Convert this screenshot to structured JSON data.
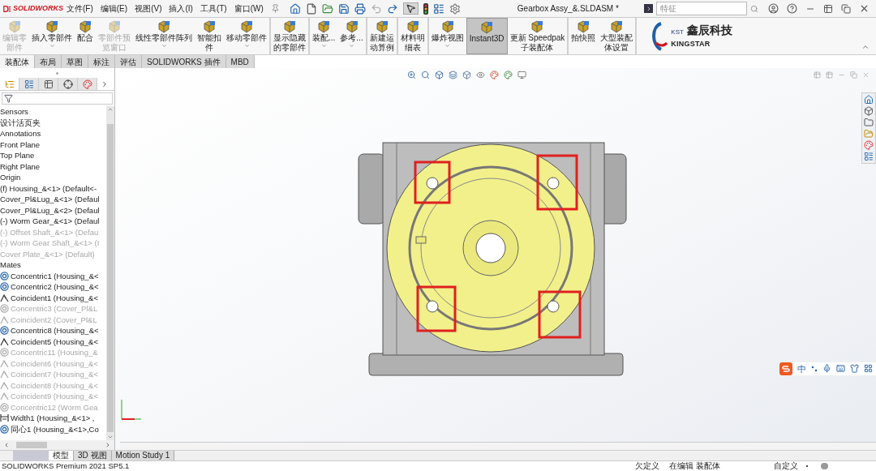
{
  "app": {
    "logo": "SOLIDWORKS",
    "menus": [
      "文件(F)",
      "编辑(E)",
      "视图(V)",
      "插入(I)",
      "工具(T)",
      "窗口(W)"
    ],
    "title": "Gearbox Assy_&.SLDASM *",
    "search": {
      "placeholder": "特征"
    }
  },
  "ribbon": {
    "buttons": [
      {
        "lines": [
          "编辑零",
          "部件"
        ],
        "disabled": true,
        "dropdown": false,
        "selected": false,
        "divider_after": false
      },
      {
        "lines": [
          "插入零部件"
        ],
        "disabled": false,
        "dropdown": true,
        "selected": false,
        "divider_after": false
      },
      {
        "lines": [
          "配合"
        ],
        "disabled": false,
        "dropdown": false,
        "selected": false,
        "divider_after": false
      },
      {
        "lines": [
          "零部件预",
          "览窗口"
        ],
        "disabled": true,
        "dropdown": false,
        "selected": false,
        "divider_after": false
      },
      {
        "lines": [
          "线性零部件阵列"
        ],
        "disabled": false,
        "dropdown": true,
        "selected": false,
        "divider_after": false
      },
      {
        "lines": [
          "智能扣",
          "件"
        ],
        "disabled": false,
        "dropdown": false,
        "selected": false,
        "divider_after": false
      },
      {
        "lines": [
          "移动零部件"
        ],
        "disabled": false,
        "dropdown": true,
        "selected": false,
        "divider_after": true
      },
      {
        "lines": [
          "显示隐藏",
          "的零部件"
        ],
        "disabled": false,
        "dropdown": false,
        "selected": false,
        "divider_after": true
      },
      {
        "lines": [
          "装配..."
        ],
        "disabled": false,
        "dropdown": true,
        "selected": false,
        "divider_after": false
      },
      {
        "lines": [
          "参考..."
        ],
        "disabled": false,
        "dropdown": true,
        "selected": false,
        "divider_after": true
      },
      {
        "lines": [
          "新建运",
          "动算例"
        ],
        "disabled": false,
        "dropdown": false,
        "selected": false,
        "divider_after": true
      },
      {
        "lines": [
          "材料明",
          "细表"
        ],
        "disabled": false,
        "dropdown": false,
        "selected": false,
        "divider_after": true
      },
      {
        "lines": [
          "爆炸视图"
        ],
        "disabled": false,
        "dropdown": true,
        "selected": false,
        "divider_after": false
      },
      {
        "lines": [
          "Instant3D"
        ],
        "disabled": false,
        "dropdown": false,
        "selected": true,
        "divider_after": false
      },
      {
        "lines": [
          "更新 Speedpak",
          "子装配体"
        ],
        "disabled": false,
        "dropdown": false,
        "selected": false,
        "divider_after": true
      },
      {
        "lines": [
          "拍快照"
        ],
        "disabled": false,
        "dropdown": false,
        "selected": false,
        "divider_after": false
      },
      {
        "lines": [
          "大型装配",
          "体设置"
        ],
        "disabled": false,
        "dropdown": false,
        "selected": false,
        "divider_after": true
      }
    ],
    "brand": {
      "mark": "KST",
      "name": "鑫辰科技",
      "sub": "KINGSTAR"
    }
  },
  "command_tabs": [
    {
      "label": "装配体",
      "selected": true
    },
    {
      "label": "布局",
      "selected": false
    },
    {
      "label": "草图",
      "selected": false
    },
    {
      "label": "标注",
      "selected": false
    },
    {
      "label": "评估",
      "selected": false
    },
    {
      "label": "SOLIDWORKS 插件",
      "selected": false
    },
    {
      "label": "MBD",
      "selected": false
    }
  ],
  "panel_tabs": [
    {
      "kind": "feature",
      "selected": true
    },
    {
      "kind": "property",
      "selected": false
    },
    {
      "kind": "config",
      "selected": false
    },
    {
      "kind": "dimxpert",
      "selected": false
    },
    {
      "kind": "display",
      "selected": false
    }
  ],
  "feature_tree": {
    "items": [
      {
        "kind": "plain",
        "label": "Sensors",
        "suppressed": false
      },
      {
        "kind": "plain",
        "label": "设计活页夹",
        "suppressed": false
      },
      {
        "kind": "plain",
        "label": "Annotations",
        "suppressed": false
      },
      {
        "kind": "plain",
        "label": "Front Plane",
        "suppressed": false
      },
      {
        "kind": "plain",
        "label": "Top Plane",
        "suppressed": false
      },
      {
        "kind": "plain",
        "label": "Right Plane",
        "suppressed": false
      },
      {
        "kind": "plain",
        "label": "Origin",
        "suppressed": false
      },
      {
        "kind": "plain",
        "label": "(f) Housing_&<1> (Default<-",
        "suppressed": false
      },
      {
        "kind": "plain",
        "label": "Cover_Pl&Lug_&<1> (Defaul",
        "suppressed": false
      },
      {
        "kind": "plain",
        "label": "Cover_Pl&Lug_&<2> (Defaul",
        "suppressed": false
      },
      {
        "kind": "plain",
        "label": "(-) Worm Gear_&<1> (Defaul",
        "suppressed": false
      },
      {
        "kind": "plain",
        "label": "(-) Offset Shaft_&<1> (Defau",
        "suppressed": true
      },
      {
        "kind": "plain",
        "label": "(-) Worm Gear Shaft_&<1> (I",
        "suppressed": true
      },
      {
        "kind": "plain",
        "label": "Cover Plate_&<1> (Default)",
        "suppressed": true
      },
      {
        "kind": "plain",
        "label": "Mates",
        "suppressed": false
      },
      {
        "kind": "concentric",
        "label": "Concentric1 (Housing_&<",
        "suppressed": false
      },
      {
        "kind": "concentric",
        "label": "Concentric2 (Housing_&<",
        "suppressed": false
      },
      {
        "kind": "coincident",
        "label": "Coincident1 (Housing_&<",
        "suppressed": false
      },
      {
        "kind": "concentric",
        "label": "Concentric3 (Cover_Pl&L",
        "suppressed": true
      },
      {
        "kind": "coincident",
        "label": "Coincident2 (Cover_Pl&L",
        "suppressed": true
      },
      {
        "kind": "concentric",
        "label": "Concentric8 (Housing_&<",
        "suppressed": false
      },
      {
        "kind": "coincident",
        "label": "Coincident5 (Housing_&<",
        "suppressed": false
      },
      {
        "kind": "concentric",
        "label": "Concentric11 (Housing_&",
        "suppressed": true
      },
      {
        "kind": "coincident",
        "label": "Coincident6 (Housing_&<",
        "suppressed": true
      },
      {
        "kind": "coincident",
        "label": "Coincident7 (Housing_&<",
        "suppressed": true
      },
      {
        "kind": "coincident",
        "label": "Coincident8 (Housing_&<",
        "suppressed": true
      },
      {
        "kind": "coincident",
        "label": "Coincident9 (Housing_&<",
        "suppressed": true
      },
      {
        "kind": "concentric",
        "label": "Concentric12 (Worm Gea",
        "suppressed": true
      },
      {
        "kind": "width",
        "label": "Width1 (Housing_&<1> ,",
        "suppressed": false
      },
      {
        "kind": "concentric",
        "label": "同心1 (Housing_&<1>,Co",
        "suppressed": false
      }
    ]
  },
  "ime": {
    "mode": "中"
  },
  "model_tabs": [
    {
      "label": "模型",
      "selected": true
    },
    {
      "label": "3D 视图",
      "selected": false
    },
    {
      "label": "Motion Study 1",
      "selected": false
    }
  ],
  "status_bar": {
    "product": "SOLIDWORKS Premium 2021 SP5.1",
    "definition": "欠定义",
    "editing": "在编辑 装配体",
    "units": "自定义"
  }
}
